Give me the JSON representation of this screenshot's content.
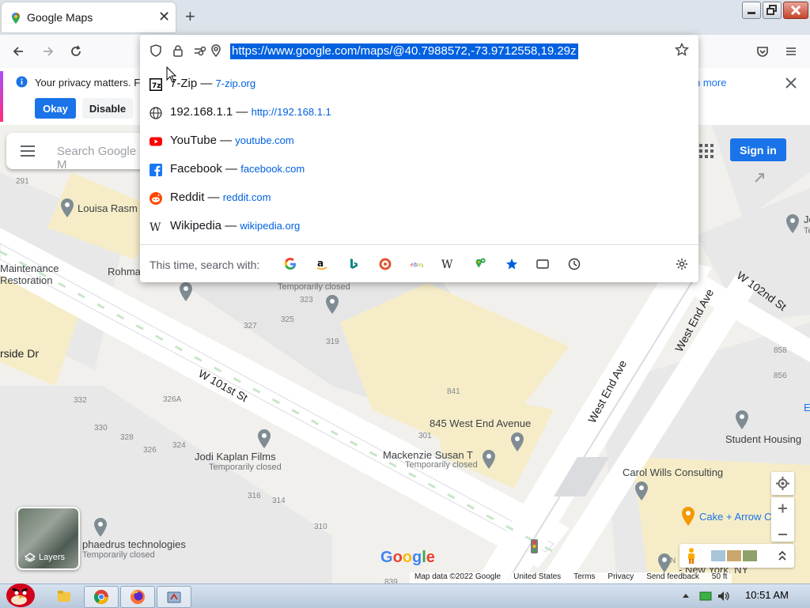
{
  "browser": {
    "tab_title": "Google Maps",
    "new_tab_glyph": "+",
    "tab_close_glyph": "✕",
    "url": "https://www.google.com/maps/@40.7988572,-73.9712558,19.29z"
  },
  "privacy_banner": {
    "text": "Your privacy matters. Fi",
    "okay_label": "Okay",
    "disable_label": "Disable",
    "learn_more_text": "n more"
  },
  "suggestions": [
    {
      "title": "7-Zip",
      "url": "7-zip.org",
      "icon": "7zip-icon"
    },
    {
      "title": "192.168.1.1",
      "url": "http://192.168.1.1",
      "icon": "globe-icon"
    },
    {
      "title": "YouTube",
      "url": "youtube.com",
      "icon": "youtube-icon"
    },
    {
      "title": "Facebook",
      "url": "facebook.com",
      "icon": "facebook-icon"
    },
    {
      "title": "Reddit",
      "url": "reddit.com",
      "icon": "reddit-icon"
    },
    {
      "title": "Wikipedia",
      "url": "wikipedia.org",
      "icon": "wikipedia-icon"
    }
  ],
  "suggestion_separator": "—",
  "search_with_label": "This time, search with:",
  "search_engines": [
    "google",
    "amazon",
    "bing",
    "duckduckgo",
    "ebay",
    "wikipedia",
    "maps",
    "bookmarks",
    "tabs",
    "history"
  ],
  "maps": {
    "search_placeholder": "Search Google M",
    "sign_in": "Sign in",
    "layers_label": "Layers",
    "google_logo": "Google",
    "footer": [
      "Map data ©2022 Google",
      "United States",
      "Terms",
      "Privacy",
      "Send feedback",
      "50 ft"
    ],
    "places": [
      {
        "name": "Louisa Rasm"
      },
      {
        "name": "Maintenance"
      },
      {
        "name": "Restoration"
      },
      {
        "name": "Rohma"
      },
      {
        "name": "rside Dr"
      },
      {
        "name": "W 101st St"
      },
      {
        "name": "W 102nd St"
      },
      {
        "name": "West End Ave"
      },
      {
        "name": "West End Ave"
      },
      {
        "name": "845 West End Avenue"
      },
      {
        "name": "Mackenzie Susan T"
      },
      {
        "name": "Jodi Kaplan Films"
      },
      {
        "name": "phaedrus technologies"
      },
      {
        "name": "Student Housing"
      },
      {
        "name": "Carol Wills Consulting"
      },
      {
        "name": "Cake + Arrow C"
      },
      {
        "name": "- New York, NY"
      },
      {
        "name": "Je"
      },
      {
        "name": "Te"
      },
      {
        "name": "E"
      }
    ],
    "subtitles": [
      "Temporarily closed",
      "Temporarily closed",
      "Temporarily closed",
      "Temporarily closed"
    ],
    "numbers": [
      "291",
      "323",
      "327",
      "325",
      "319",
      "841",
      "332",
      "326A",
      "330",
      "328",
      "326",
      "324",
      "301",
      "316",
      "314",
      "310",
      "839",
      "858",
      "856",
      "N"
    ]
  },
  "taskbar": {
    "clock": "10:51 AM"
  },
  "colors": {
    "accent_blue": "#1a73e8",
    "url_highlight": "#0061e0"
  }
}
